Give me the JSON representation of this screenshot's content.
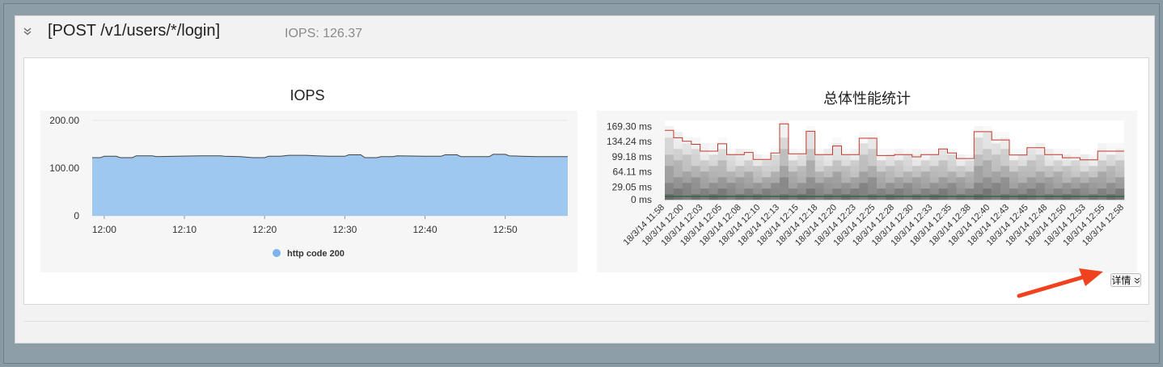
{
  "header": {
    "collapse_icon": "double-chevron-down-icon",
    "title": "[POST /v1/users/*/login]",
    "iops_summary": "IOPS: 126.37"
  },
  "iops_chart": {
    "title": "IOPS",
    "legend_label": "http code 200"
  },
  "perf_chart": {
    "title": "总体性能统计"
  },
  "detail_button": {
    "label": "详情",
    "icon": "double-chevron-down-icon"
  },
  "annotation": {
    "arrow_icon": "red-arrow-icon",
    "color": "#f0421f"
  },
  "colors": {
    "area": "#9ec8f0",
    "area_line": "#444444",
    "perf_line": "#c0392b",
    "legend_dot": "#7cb5ec"
  },
  "chart_data": [
    {
      "type": "area",
      "title": "IOPS",
      "ylim": [
        0,
        200
      ],
      "yticks": [
        "200.00",
        "100.00",
        "0"
      ],
      "xtick_labels": [
        "12:00",
        "12:10",
        "12:20",
        "12:30",
        "12:40",
        "12:50"
      ],
      "x_range_minutes": [
        -1.5,
        57.8
      ],
      "series": [
        {
          "name": "http code 200",
          "points": [
            [
              -1.5,
              122
            ],
            [
              -0.5,
              122
            ],
            [
              0,
              125
            ],
            [
              1.5,
              125
            ],
            [
              2,
              122
            ],
            [
              3.5,
              122
            ],
            [
              4,
              126
            ],
            [
              6,
              126
            ],
            [
              6.5,
              124
            ],
            [
              9,
              125
            ],
            [
              12,
              126
            ],
            [
              14.5,
              126
            ],
            [
              15,
              125
            ],
            [
              17,
              124
            ],
            [
              18.5,
              122
            ],
            [
              20,
              122
            ],
            [
              20.5,
              125
            ],
            [
              22,
              125
            ],
            [
              23,
              127
            ],
            [
              25,
              127
            ],
            [
              26.5,
              126
            ],
            [
              28,
              125
            ],
            [
              30,
              125
            ],
            [
              30.5,
              128
            ],
            [
              32,
              128
            ],
            [
              32.5,
              122
            ],
            [
              34,
              122
            ],
            [
              34.5,
              124
            ],
            [
              36,
              124
            ],
            [
              36.5,
              126
            ],
            [
              40,
              125
            ],
            [
              42,
              125
            ],
            [
              42.5,
              128
            ],
            [
              44,
              128
            ],
            [
              44.5,
              124
            ],
            [
              48,
              124
            ],
            [
              48.5,
              129
            ],
            [
              50,
              129
            ],
            [
              50.5,
              126
            ],
            [
              52,
              125
            ],
            [
              54,
              124
            ],
            [
              57.8,
              124
            ]
          ]
        }
      ]
    },
    {
      "type": "heatmap",
      "title": "总体性能统计",
      "yticks": [
        "169.30 ms",
        "134.24 ms",
        "99.18 ms",
        "64.11 ms",
        "29.05 ms",
        "0 ms"
      ],
      "ylim": [
        0,
        183
      ],
      "x": [
        "18/3/14 11:58",
        "18/3/14 12:00",
        "18/3/14 12:03",
        "18/3/14 12:05",
        "18/3/14 12:08",
        "18/3/14 12:10",
        "18/3/14 12:13",
        "18/3/14 12:15",
        "18/3/14 12:18",
        "18/3/14 12:20",
        "18/3/14 12:23",
        "18/3/14 12:25",
        "18/3/14 12:28",
        "18/3/14 12:30",
        "18/3/14 12:33",
        "18/3/14 12:35",
        "18/3/14 12:38",
        "18/3/14 12:40",
        "18/3/14 12:43",
        "18/3/14 12:45",
        "18/3/14 12:48",
        "18/3/14 12:50",
        "18/3/14 12:53",
        "18/3/14 12:55",
        "18/3/14 12:58"
      ],
      "series": [
        {
          "line_values": [
            160,
            143,
            135,
            128,
            112,
            112,
            129,
            104,
            104,
            109,
            93,
            93,
            108,
            175,
            106,
            106,
            158,
            104,
            104,
            124,
            104,
            104,
            142,
            142,
            102,
            102,
            104,
            104,
            99,
            104,
            104,
            117,
            108,
            95,
            95,
            157,
            157,
            138,
            138,
            103,
            103,
            120,
            120,
            104,
            104,
            97,
            97,
            92,
            92,
            112,
            112,
            112
          ]
        }
      ]
    }
  ]
}
